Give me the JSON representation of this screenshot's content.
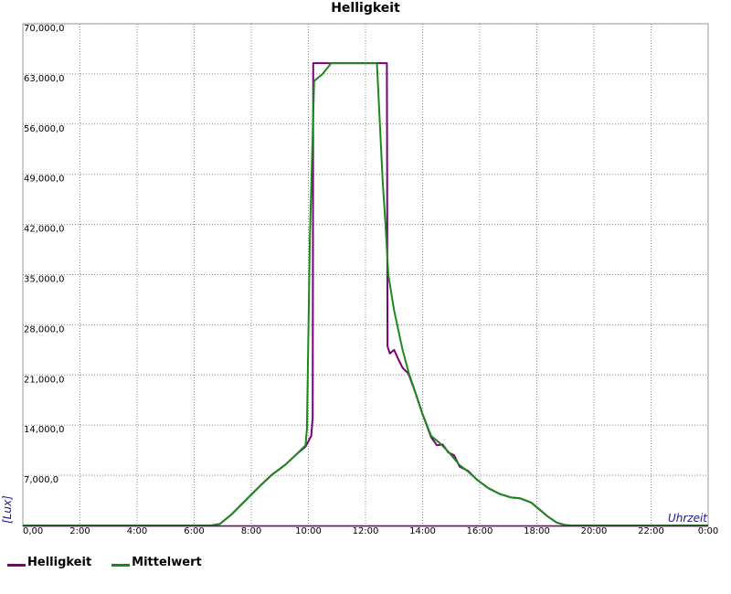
{
  "chart_data": {
    "type": "line",
    "title": "Helligkeit",
    "xlabel": "Uhrzeit",
    "ylabel": "[Lux]",
    "xlim": [
      0,
      24
    ],
    "ylim": [
      0,
      70000
    ],
    "grid": true,
    "legend_position": "bottom-left",
    "x_tick_labels": [
      "0,00",
      "2:00",
      "4:00",
      "6:00",
      "8:00",
      "10:00",
      "12:00",
      "14:00",
      "16:00",
      "18:00",
      "20:00",
      "22:00",
      "0:00"
    ],
    "y_tick_labels": [
      "7,000,0",
      "14,000,0",
      "21,000,0",
      "28,000,0",
      "35,000,0",
      "42,000,0",
      "49,000,0",
      "56,000,0",
      "63,000,0",
      "70,000,0"
    ],
    "y_tick_values": [
      7000,
      14000,
      21000,
      28000,
      35000,
      42000,
      49000,
      56000,
      63000,
      70000
    ],
    "series": [
      {
        "name": "Helligkeit",
        "color": "#7b007b",
        "points": [
          [
            0,
            0
          ],
          [
            6.6,
            0
          ],
          [
            6.9,
            200
          ],
          [
            7.3,
            1500
          ],
          [
            7.8,
            3500
          ],
          [
            8.3,
            5500
          ],
          [
            8.7,
            7000
          ],
          [
            9.2,
            8500
          ],
          [
            9.6,
            10000
          ],
          [
            9.9,
            11000
          ],
          [
            10.1,
            12500
          ],
          [
            10.15,
            15000
          ],
          [
            10.17,
            64500
          ],
          [
            12.75,
            64500
          ],
          [
            12.77,
            25000
          ],
          [
            12.85,
            24000
          ],
          [
            13.0,
            24500
          ],
          [
            13.15,
            23200
          ],
          [
            13.3,
            22000
          ],
          [
            13.5,
            21200
          ],
          [
            13.75,
            18500
          ],
          [
            14.0,
            15500
          ],
          [
            14.3,
            12300
          ],
          [
            14.5,
            11200
          ],
          [
            14.7,
            11300
          ],
          [
            14.9,
            10200
          ],
          [
            15.1,
            9800
          ],
          [
            15.3,
            8200
          ],
          [
            15.6,
            7600
          ],
          [
            15.9,
            6400
          ],
          [
            16.3,
            5200
          ],
          [
            16.7,
            4400
          ],
          [
            17.1,
            3900
          ],
          [
            17.4,
            3800
          ],
          [
            17.8,
            3200
          ],
          [
            18.1,
            2200
          ],
          [
            18.4,
            1200
          ],
          [
            18.7,
            400
          ],
          [
            19.0,
            50
          ],
          [
            19.2,
            0
          ],
          [
            24,
            0
          ]
        ]
      },
      {
        "name": "Mittelwert",
        "color": "#1a8a1a",
        "points": [
          [
            0,
            0
          ],
          [
            6.6,
            0
          ],
          [
            6.9,
            200
          ],
          [
            7.3,
            1500
          ],
          [
            7.8,
            3500
          ],
          [
            8.3,
            5500
          ],
          [
            8.7,
            7000
          ],
          [
            9.2,
            8500
          ],
          [
            9.6,
            10000
          ],
          [
            9.9,
            11200
          ],
          [
            9.95,
            13500
          ],
          [
            10.05,
            40000
          ],
          [
            10.2,
            62000
          ],
          [
            10.5,
            63000
          ],
          [
            10.8,
            64500
          ],
          [
            12.4,
            64500
          ],
          [
            12.6,
            48000
          ],
          [
            12.7,
            42000
          ],
          [
            12.8,
            35000
          ],
          [
            13.0,
            30000
          ],
          [
            13.3,
            24500
          ],
          [
            13.5,
            21500
          ],
          [
            13.75,
            18500
          ],
          [
            14.0,
            15500
          ],
          [
            14.3,
            12500
          ],
          [
            14.6,
            11500
          ],
          [
            14.9,
            10300
          ],
          [
            15.3,
            8400
          ],
          [
            15.6,
            7500
          ],
          [
            15.9,
            6400
          ],
          [
            16.3,
            5200
          ],
          [
            16.7,
            4400
          ],
          [
            17.1,
            3900
          ],
          [
            17.4,
            3800
          ],
          [
            17.8,
            3200
          ],
          [
            18.1,
            2200
          ],
          [
            18.4,
            1200
          ],
          [
            18.7,
            400
          ],
          [
            19.0,
            50
          ],
          [
            19.2,
            0
          ],
          [
            24,
            0
          ]
        ]
      }
    ]
  }
}
